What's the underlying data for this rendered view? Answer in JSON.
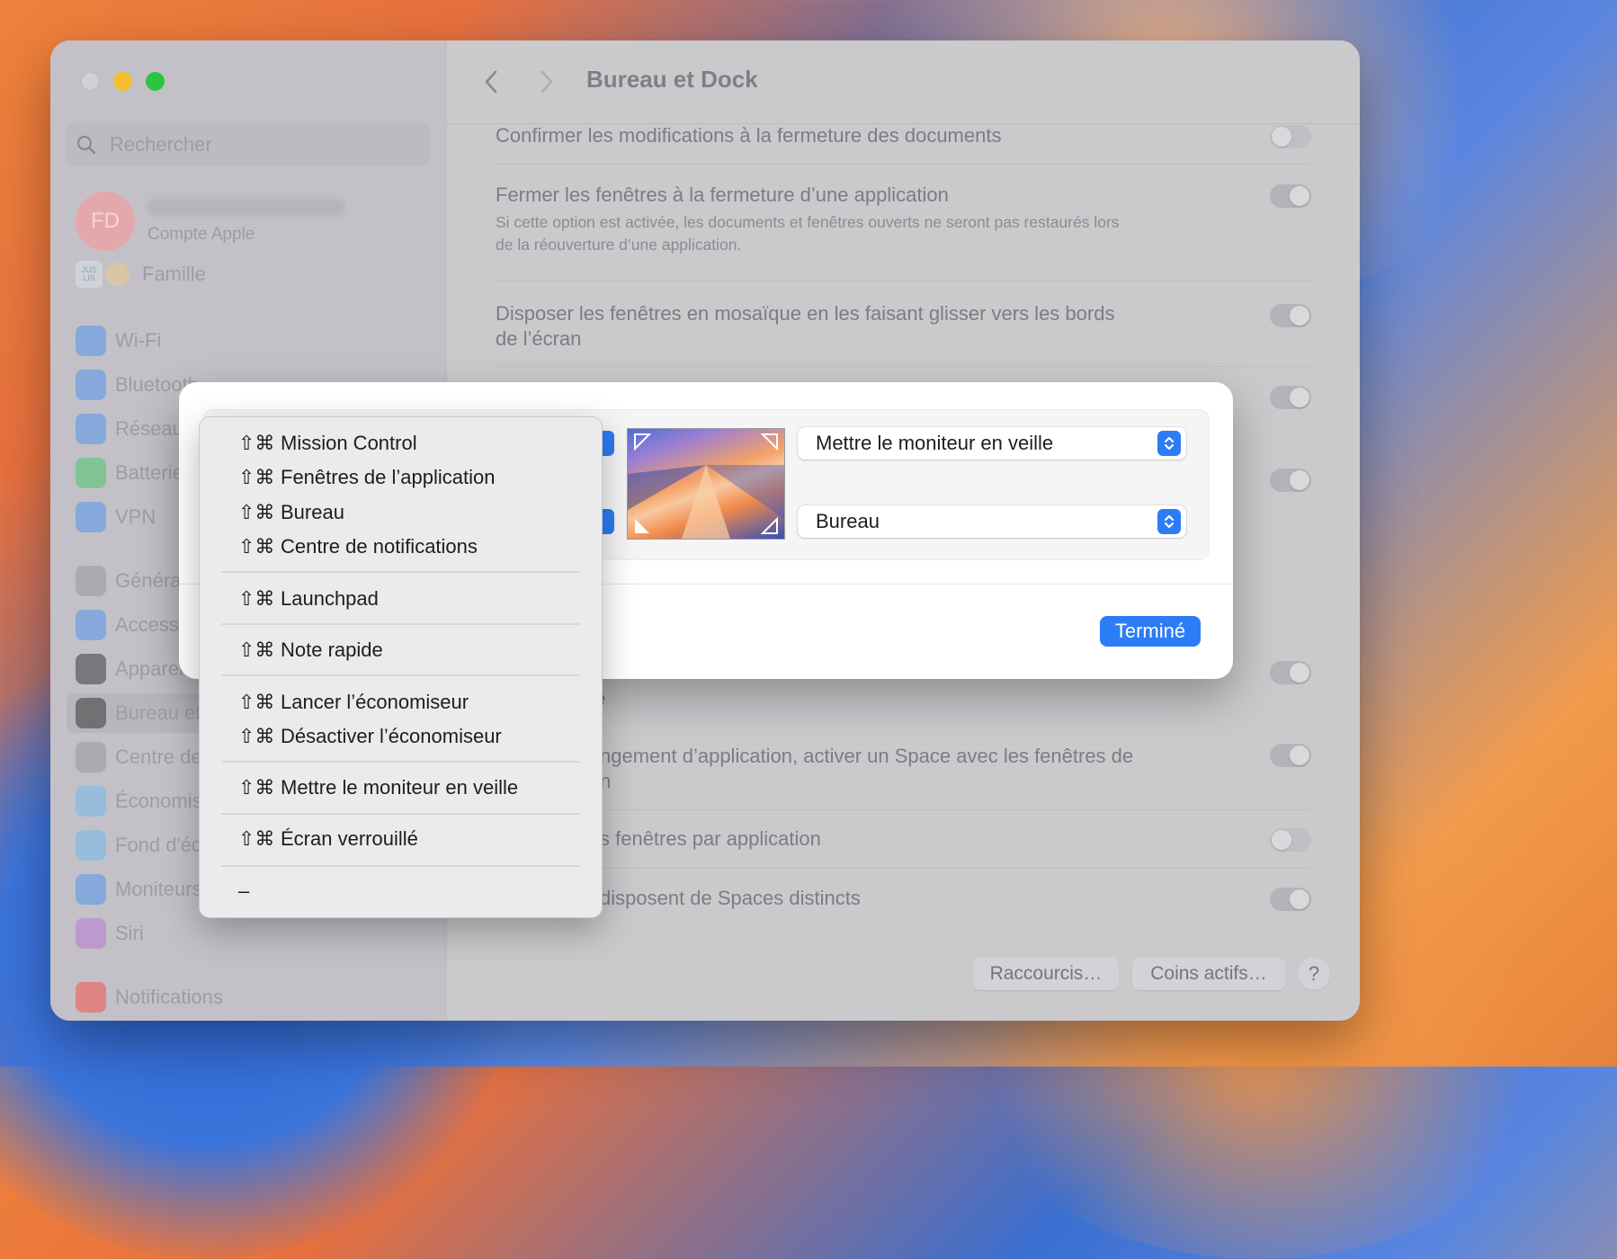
{
  "window": {
    "title": "Bureau et Dock"
  },
  "sidebar": {
    "search_placeholder": "Rechercher",
    "account": {
      "initials": "FD",
      "subtitle": "Compte Apple"
    },
    "family": {
      "badge": "JUS LIS",
      "label": "Famille"
    },
    "items": [
      {
        "label": "Wi-Fi",
        "icon": "wifi-icon",
        "color": "#3b8cf5"
      },
      {
        "label": "Bluetooth",
        "icon": "bluetooth-icon",
        "color": "#3b8cf5"
      },
      {
        "label": "Réseau",
        "icon": "globe-icon",
        "color": "#3b8cf5"
      },
      {
        "label": "Batterie",
        "icon": "battery-icon",
        "color": "#34c759"
      },
      {
        "label": "VPN",
        "icon": "vpn-globe-icon",
        "color": "#3b8cf5"
      },
      {
        "label": "Général",
        "icon": "gear-icon",
        "color": "#8e8e93"
      },
      {
        "label": "Accessibilité",
        "icon": "accessibility-icon",
        "color": "#3b8cf5"
      },
      {
        "label": "Apparence",
        "icon": "appearance-icon",
        "color": "#1d1d1f"
      },
      {
        "label": "Bureau et Dock",
        "icon": "dock-icon",
        "color": "#1d1d1f"
      },
      {
        "label": "Centre de contrôle",
        "icon": "control-center-icon",
        "color": "#8e8e93"
      },
      {
        "label": "Économiseur d'écran",
        "icon": "screensaver-icon",
        "color": "#64b5f6"
      },
      {
        "label": "Fond d'écran",
        "icon": "wallpaper-icon",
        "color": "#64b5f6"
      },
      {
        "label": "Moniteurs",
        "icon": "brightness-icon",
        "color": "#3b8cf5"
      },
      {
        "label": "Siri",
        "icon": "siri-icon",
        "color": "#b46bd6"
      },
      {
        "label": "Notifications",
        "icon": "bell-icon",
        "color": "#ff3b30"
      }
    ]
  },
  "settings": {
    "row1": {
      "label": "Confirmer les modifications à la fermeture des documents"
    },
    "row2": {
      "label": "Fermer les fenêtres à la fermeture d’une application",
      "desc1": "Si cette option est activée, les documents et fenêtres ouverts ne seront pas restaurés lors",
      "desc2": "de la réouverture d’une application."
    },
    "row3": {
      "label1": "Disposer les fenêtres en mosaïque en les faisant glisser vers les bords",
      "label2": "de l’écran"
    },
    "row_hidden1": {
      "tail": "e"
    },
    "row_switch": {
      "label1": "ngement d’application, activer un Space avec les fenêtres de",
      "label2": "n"
    },
    "row_group": {
      "label": "s fenêtres par application"
    },
    "row_spaces": {
      "label": "disposent de Spaces distincts"
    },
    "buttons": {
      "shortcuts": "Raccourcis…",
      "hot_corners": "Coins actifs…",
      "help": "?"
    }
  },
  "modal": {
    "top_right": "Mettre le moniteur en veille",
    "bottom_right": "Bureau",
    "done": "Terminé"
  },
  "menu": {
    "keys": "⇧⌘",
    "items": [
      "Mission Control",
      "Fenêtres de l’application",
      "Bureau",
      "Centre de notifications",
      "Launchpad",
      "Note rapide",
      "Lancer l’économiseur",
      "Désactiver l’économiseur",
      "Mettre le moniteur en veille",
      "Écran verrouillé"
    ],
    "none_label": "–"
  },
  "colors": {
    "accent": "#2c7cf6"
  }
}
